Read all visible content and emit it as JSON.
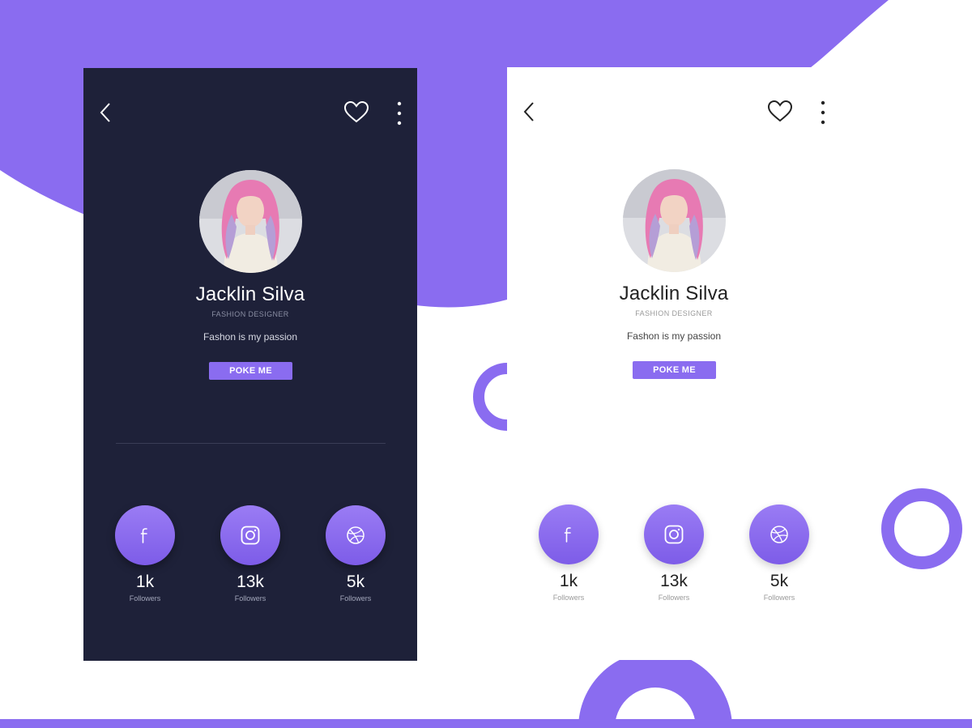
{
  "colors": {
    "accent": "#8a6cf0",
    "dark_bg": "#1e2139",
    "light_bg": "#ffffff"
  },
  "screens": [
    {
      "theme": "dark",
      "icons": {
        "back": "chevron-left-icon",
        "favorite": "heart-icon",
        "menu": "more-vertical-icon"
      },
      "profile": {
        "name": "Jacklin Silva",
        "role": "FASHION DESIGNER",
        "bio": "Fashon is my passion",
        "button": "POKE ME"
      },
      "stats": [
        {
          "icon": "facebook-icon",
          "count": "1k",
          "label": "Followers"
        },
        {
          "icon": "instagram-icon",
          "count": "13k",
          "label": "Followers"
        },
        {
          "icon": "dribbble-icon",
          "count": "5k",
          "label": "Followers"
        }
      ]
    },
    {
      "theme": "light",
      "icons": {
        "back": "chevron-left-icon",
        "favorite": "heart-icon",
        "menu": "more-vertical-icon"
      },
      "profile": {
        "name": "Jacklin Silva",
        "role": "FASHION DESIGNER",
        "bio": "Fashon is my passion",
        "button": "POKE ME"
      },
      "stats": [
        {
          "icon": "facebook-icon",
          "count": "1k",
          "label": "Followers"
        },
        {
          "icon": "instagram-icon",
          "count": "13k",
          "label": "Followers"
        },
        {
          "icon": "dribbble-icon",
          "count": "5k",
          "label": "Followers"
        }
      ]
    }
  ]
}
